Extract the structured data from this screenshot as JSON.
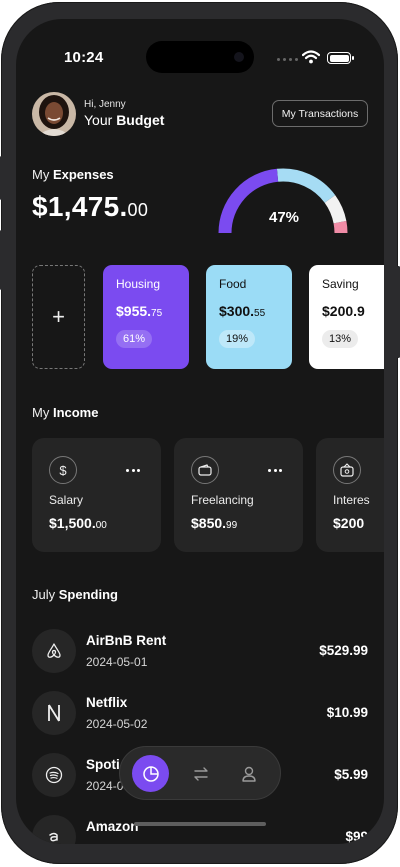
{
  "status_bar": {
    "time": "10:24"
  },
  "header": {
    "greeting": "Hi, Jenny",
    "title_prefix": "Your ",
    "title_bold": "Budget",
    "transactions_button": "My Transactions"
  },
  "expenses": {
    "title_prefix": "My ",
    "title_bold": "Expenses",
    "amount_main": "$1,475.",
    "amount_cents": "00",
    "gauge_percent": 47,
    "gauge_label": "47%",
    "add_symbol": "+",
    "categories": [
      {
        "name": "Housing",
        "amount_main": "$955.",
        "amount_cents": "75",
        "percent": "61%",
        "color": "#7b4bf0"
      },
      {
        "name": "Food",
        "amount_main": "$300.",
        "amount_cents": "55",
        "percent": "19%",
        "color": "#9bdcf6"
      },
      {
        "name": "Saving",
        "amount_main": "$200.9",
        "amount_cents": "",
        "percent": "13%",
        "color": "#ffffff"
      }
    ]
  },
  "income": {
    "title_prefix": "My ",
    "title_bold": "Income",
    "items": [
      {
        "icon": "dollar-icon",
        "label": "Salary",
        "amount_main": "$1,500.",
        "amount_cents": "00"
      },
      {
        "icon": "wallet-icon",
        "label": "Freelancing",
        "amount_main": "$850.",
        "amount_cents": "99"
      },
      {
        "icon": "interest-wallet-icon",
        "label": "Interes",
        "amount_main": "$200",
        "amount_cents": ""
      }
    ]
  },
  "spending": {
    "title_prefix": "July ",
    "title_bold": "Spending",
    "items": [
      {
        "icon": "airbnb-icon",
        "name": "AirBnB Rent",
        "date": "2024-05-01",
        "amount": "$529.99"
      },
      {
        "icon": "netflix-icon",
        "name": "Netflix",
        "date": "2024-05-02",
        "amount": "$10.99"
      },
      {
        "icon": "spotify-icon",
        "name": "Spoti",
        "date": "2024-0",
        "amount": "$5.99"
      },
      {
        "icon": "amazon-icon",
        "name": "Amazon",
        "date": "",
        "amount": "$99"
      }
    ]
  },
  "colors": {
    "accent": "#7b4bf0",
    "food": "#9bdcf6",
    "background": "#171717",
    "gauge_track_blue": "#a6dcf4",
    "gauge_track_pink": "#f08ca6"
  }
}
